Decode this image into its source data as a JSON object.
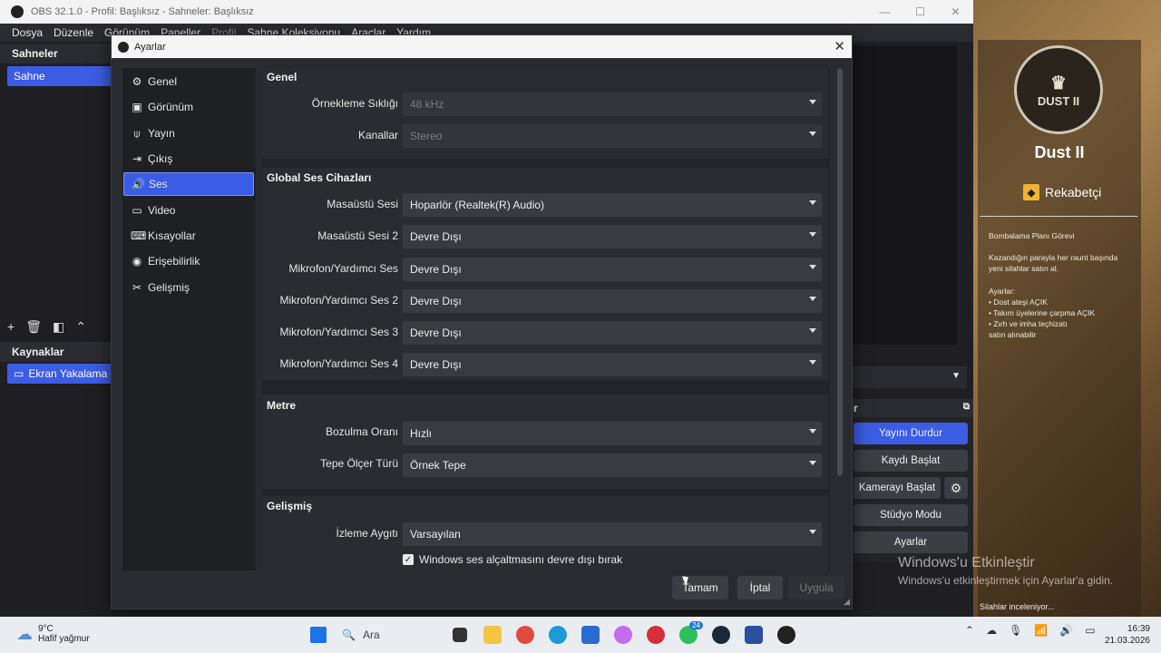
{
  "obs": {
    "title": "OBS 32.1.0 - Profil: Başlıksız - Sahneler: Başlıksız",
    "menu": [
      "Dosya",
      "Düzenle",
      "Görünüm",
      "Paneller",
      "Profil",
      "Sahne Koleksiyonu",
      "Araçlar",
      "Yardım"
    ],
    "scenes_title": "Sahneler",
    "scene_selected": "Sahne",
    "sources_title": "Kaynaklar",
    "source_selected": "Ekran Yakalama",
    "controls_title": "r",
    "controls": [
      "Yayını Durdur",
      "Kaydı Başlat",
      "Kamerayı Başlat",
      "Stüdyo Modu",
      "Ayarlar"
    ]
  },
  "dialog": {
    "title": "Ayarlar",
    "sidebar": [
      {
        "label": "Genel",
        "icon": "gear-icon"
      },
      {
        "label": "Görünüm",
        "icon": "appearance-icon"
      },
      {
        "label": "Yayın",
        "icon": "broadcast-icon"
      },
      {
        "label": "Çıkış",
        "icon": "output-icon"
      },
      {
        "label": "Ses",
        "icon": "speaker-icon"
      },
      {
        "label": "Video",
        "icon": "monitor-icon"
      },
      {
        "label": "Kısayollar",
        "icon": "keyboard-icon"
      },
      {
        "label": "Erişebilirlik",
        "icon": "accessibility-icon"
      },
      {
        "label": "Gelişmiş",
        "icon": "tools-icon"
      }
    ],
    "selected_index": 4,
    "groups": {
      "genel": {
        "title": "Genel",
        "sample_rate_label": "Örnekleme Sıklığı",
        "sample_rate_value": "48 kHz",
        "channels_label": "Kanallar",
        "channels_value": "Stereo"
      },
      "global": {
        "title": "Global Ses Cihazları",
        "rows": [
          {
            "label": "Masaüstü Sesi",
            "value": "Hoparlör (Realtek(R) Audio)"
          },
          {
            "label": "Masaüstü Sesi 2",
            "value": "Devre Dışı"
          },
          {
            "label": "Mikrofon/Yardımcı Ses",
            "value": "Devre Dışı"
          },
          {
            "label": "Mikrofon/Yardımcı Ses 2",
            "value": "Devre Dışı"
          },
          {
            "label": "Mikrofon/Yardımcı Ses 3",
            "value": "Devre Dışı"
          },
          {
            "label": "Mikrofon/Yardımcı Ses 4",
            "value": "Devre Dışı"
          }
        ]
      },
      "metre": {
        "title": "Metre",
        "decay_label": "Bozulma Oranı",
        "decay_value": "Hızlı",
        "peak_label": "Tepe Ölçer Türü",
        "peak_value": "Örnek Tepe"
      },
      "gelismis": {
        "title": "Gelişmiş",
        "monitor_label": "İzleme Aygıtı",
        "monitor_value": "Varsayılan",
        "ducking_label": "Windows ses alçaltmasını devre dışı bırak",
        "ducking_checked": true
      }
    },
    "buttons": {
      "ok": "Tamam",
      "cancel": "İptal",
      "apply": "Uygula"
    }
  },
  "desktop": {
    "emblem_text": "DUST II",
    "map_name": "Dust II",
    "mode": "Rekabetçi",
    "rules": {
      "l1": "Bombalama Planı Görevi",
      "l2": "Kazandığın parayla her raunt başında",
      "l3": "yeni silahlar satın al.",
      "l4": "Ayarlar:",
      "l5": "• Dost ateşi AÇIK",
      "l6": "• Takım üyelerine çarpma AÇIK",
      "l7": "• Zırh ve imha teçhizatı",
      "l8": "  satın alınabilir"
    },
    "activate_title": "Windows'u Etkinleştir",
    "activate_sub": "Windows'u etkinleştirmek için Ayarlar'a gidin.",
    "weapons": "Silahlar inceleniyor..."
  },
  "taskbar": {
    "temp": "9°C",
    "weather": "Hafif yağmur",
    "search_placeholder": "Ara",
    "badge": "24",
    "time": "16:39",
    "date": "21.03.2026"
  }
}
